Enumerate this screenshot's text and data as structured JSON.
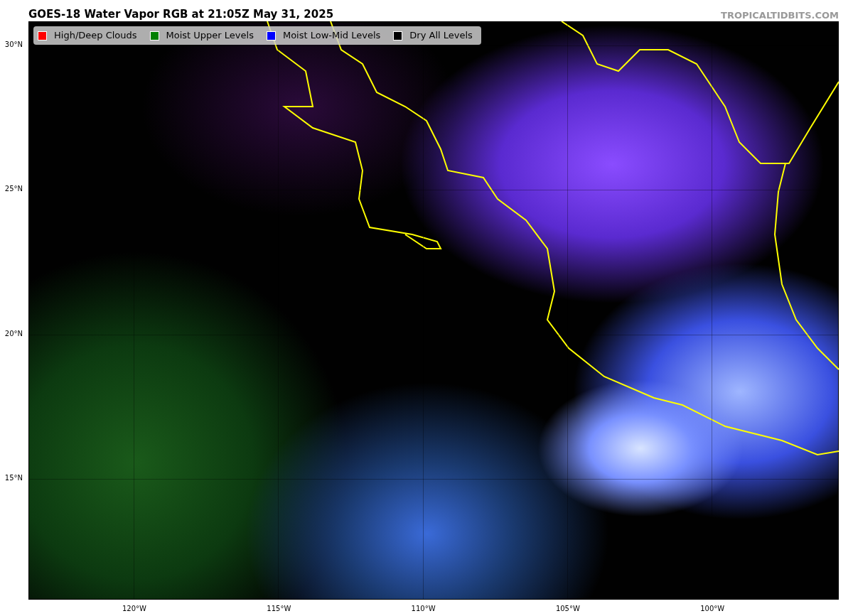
{
  "title": "GOES-18 Water Vapor RGB at 21:05Z May 31, 2025",
  "credit": "TROPICALTIDBITS.COM",
  "legend": [
    {
      "label": "High/Deep Clouds",
      "color": "#ff0000"
    },
    {
      "label": "Moist Upper Levels",
      "color": "#008000"
    },
    {
      "label": "Moist Low-Mid Levels",
      "color": "#0000ff"
    },
    {
      "label": "Dry All Levels",
      "color": "#000000"
    }
  ],
  "map": {
    "yticks": [
      "30°N",
      "25°N",
      "20°N",
      "15°N"
    ],
    "xticks": [
      "120°W",
      "115°W",
      "110°W",
      "105°W",
      "100°W"
    ]
  }
}
